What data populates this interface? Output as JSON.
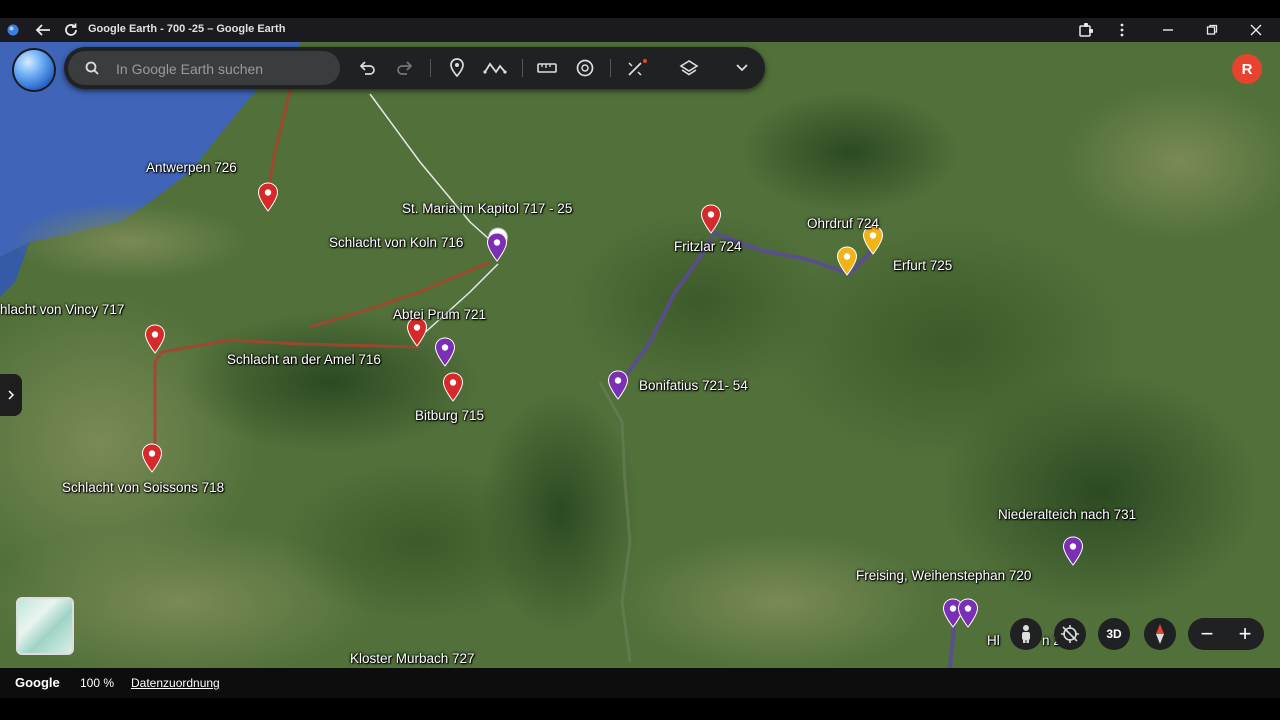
{
  "window": {
    "title": "Google Earth - 700 -25 – Google Earth"
  },
  "search": {
    "placeholder": "In Google Earth suchen"
  },
  "account": {
    "initial": "R",
    "color": "#e8432e"
  },
  "icons": {
    "back": "arrow-left-icon",
    "reload": "reload-icon",
    "extensions": "puzzle-icon",
    "menu": "kebab-menu-icon",
    "minimize": "minimize-icon",
    "maximize": "restore-icon",
    "close": "close-icon",
    "search": "search-icon",
    "undo": "undo-icon",
    "redo": "redo-icon",
    "placemark": "placemark-icon",
    "path": "path-icon",
    "measure": "ruler-icon",
    "history": "history-icon",
    "tools": "magic-wand-icon",
    "layers": "layers-icon",
    "more": "chevron-down-icon"
  },
  "placemarks": [
    {
      "label": "Antwerpen 726",
      "color": "#d62a2a"
    },
    {
      "label": "St. Maria im Kapitol 717 - 25",
      "color": "#ffffff"
    },
    {
      "label": "Schlacht von Koln 716",
      "color": "#7a2fb5"
    },
    {
      "label": "Fritzlar 724",
      "color": "#d62a2a"
    },
    {
      "label": "Ohrdruf 724",
      "color": "#f0b419"
    },
    {
      "label": "Erfurt 725",
      "color": "#f0b419"
    },
    {
      "label": "hlacht von Vincy 717",
      "color": "#d62a2a"
    },
    {
      "label": "Abtei Prum 721",
      "color": "#d62a2a"
    },
    {
      "label": "Schlacht an der Amel 716",
      "color": "#7a2fb5"
    },
    {
      "label": "Bitburg 715",
      "color": "#d62a2a"
    },
    {
      "label": "Bonifatius 721- 54",
      "color": "#7a2fb5"
    },
    {
      "label": "Schlacht von Soissons 718",
      "color": "#d62a2a"
    },
    {
      "label": "Niederalteich nach 731",
      "color": "#7a2fb5"
    },
    {
      "label": "Freising, Weihenstephan 720",
      "color": "#7a2fb5"
    },
    {
      "label": "Kloster Murbach 727",
      "color": "#7a2fb5"
    },
    {
      "label": "Hl",
      "color": "#7a2fb5"
    },
    {
      "label": "n 20",
      "color": "#7a2fb5"
    }
  ],
  "controls": {
    "mode_3d": "3D",
    "zoom_out": "−",
    "zoom_in": "+"
  },
  "statusbar": {
    "brand": "Google",
    "zoom": "100 %",
    "attribution": "Datenzuordnung"
  }
}
